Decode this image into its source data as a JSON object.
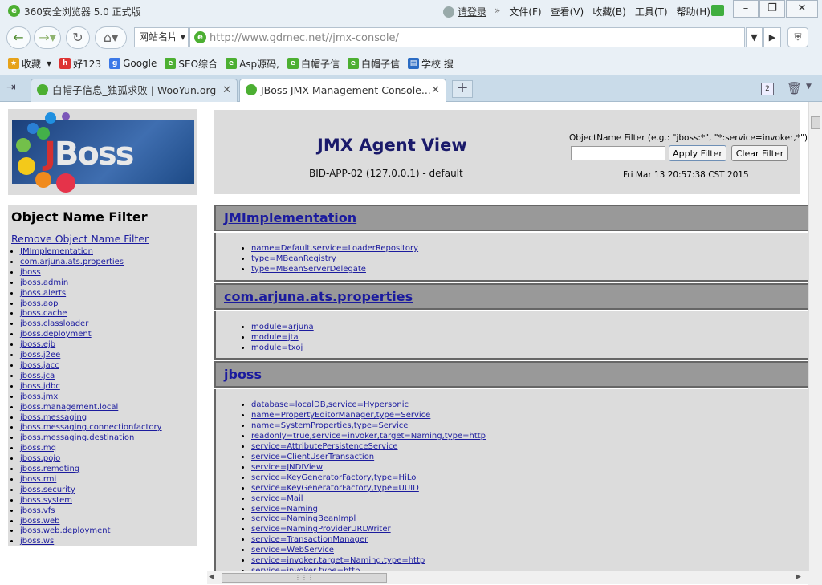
{
  "window": {
    "title": "360安全浏览器 5.0 正式版",
    "login": "请登录",
    "menu": [
      "文件(F)",
      "查看(V)",
      "收藏(B)",
      "工具(T)",
      "帮助(H)"
    ]
  },
  "nav": {
    "favsite_label": "网站名片",
    "url": "http://www.gdmec.net//jmx-console/"
  },
  "bookmarks": [
    {
      "label": "收藏",
      "icon": "star-icon",
      "color": "#e6a21a"
    },
    {
      "label": "好123",
      "icon": "hao123-icon",
      "color": "#d33"
    },
    {
      "label": "Google",
      "icon": "google-icon",
      "color": "#3b78e7"
    },
    {
      "label": "SEO综合",
      "icon": "page-icon",
      "color": "#4caf32"
    },
    {
      "label": "Asp源码,",
      "icon": "page-icon",
      "color": "#4caf32"
    },
    {
      "label": "白帽子信",
      "icon": "page-icon",
      "color": "#4caf32"
    },
    {
      "label": "白帽子信",
      "icon": "page-icon",
      "color": "#4caf32"
    },
    {
      "label": "学校 搜",
      "icon": "chart-icon",
      "color": "#2b6cc4"
    }
  ],
  "tabs": [
    {
      "label": "白帽子信息_独孤求败 | WooYun.org",
      "active": false
    },
    {
      "label": "JBoss JMX Management Console...",
      "active": true
    }
  ],
  "tab_count": "2",
  "page": {
    "filter_title": "Object Name Filter",
    "remove_filter": "Remove Object Name Filter",
    "domain_list": [
      "JMImplementation",
      "com.arjuna.ats.properties",
      "jboss",
      "jboss.admin",
      "jboss.alerts",
      "jboss.aop",
      "jboss.cache",
      "jboss.classloader",
      "jboss.deployment",
      "jboss.ejb",
      "jboss.j2ee",
      "jboss.jacc",
      "jboss.jca",
      "jboss.jdbc",
      "jboss.jmx",
      "jboss.management.local",
      "jboss.messaging",
      "jboss.messaging.connectionfactory",
      "jboss.messaging.destination",
      "jboss.mq",
      "jboss.pojo",
      "jboss.remoting",
      "jboss.rmi",
      "jboss.security",
      "jboss.system",
      "jboss.vfs",
      "jboss.web",
      "jboss.web.deployment",
      "jboss.ws"
    ],
    "agent_title": "JMX Agent View",
    "agent_subtitle": "BID-APP-02 (127.0.0.1) - default",
    "filter_label": "ObjectName Filter (e.g.: \"jboss:*\", \"*:service=invoker,*\"):",
    "filter_value": "",
    "apply_button": "Apply Filter",
    "clear_button": "Clear Filter",
    "timestamp": "Fri Mar 13 20:57:38 CST 2015",
    "domains": [
      {
        "name": "JMImplementation",
        "mbeans": [
          "name=Default,service=LoaderRepository",
          "type=MBeanRegistry",
          "type=MBeanServerDelegate"
        ]
      },
      {
        "name": "com.arjuna.ats.properties",
        "mbeans": [
          "module=arjuna",
          "module=jta",
          "module=txoj"
        ]
      },
      {
        "name": "jboss",
        "mbeans": [
          "database=localDB,service=Hypersonic",
          "name=PropertyEditorManager,type=Service",
          "name=SystemProperties,type=Service",
          "readonly=true,service=invoker,target=Naming,type=http",
          "service=AttributePersistenceService",
          "service=ClientUserTransaction",
          "service=JNDIView",
          "service=KeyGeneratorFactory,type=HiLo",
          "service=KeyGeneratorFactory,type=UUID",
          "service=Mail",
          "service=Naming",
          "service=NamingBeanImpl",
          "service=NamingProviderURLWriter",
          "service=TransactionManager",
          "service=WebService",
          "service=invoker,target=Naming,type=http",
          "service=invoker,type=http"
        ]
      }
    ]
  }
}
